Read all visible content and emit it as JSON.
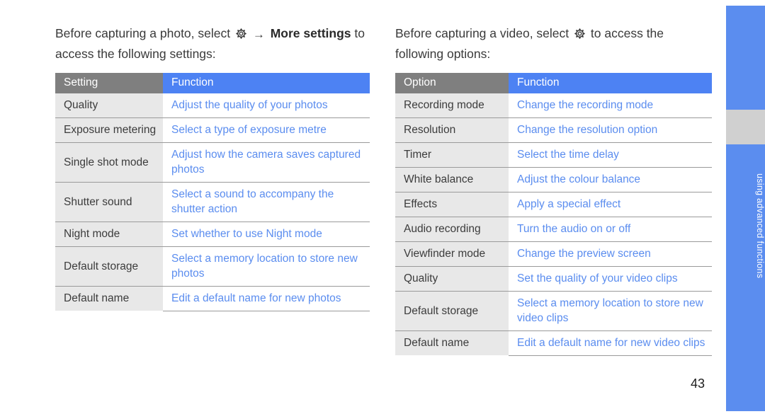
{
  "side_tab": {
    "label": "using advanced functions",
    "color": "#5b8def",
    "gap_color": "#d0d0d0"
  },
  "page_number": "43",
  "colors": {
    "accent_blue": "#5b8def",
    "header_blue": "#4d82f3",
    "header_gray": "#7f7f7f",
    "row_gray": "#e8e8e8"
  },
  "left": {
    "intro_part1": "Before capturing a photo, select",
    "intro_icon": "gear-icon",
    "intro_arrow": "→",
    "intro_bold1": "More settings",
    "intro_part2": "to access the following settings:",
    "headers": [
      "Setting",
      "Function"
    ],
    "rows": [
      {
        "option": "Quality",
        "function": "Adjust the quality of your photos"
      },
      {
        "option": "Exposure metering",
        "function": "Select a type of exposure metre"
      },
      {
        "option": "Single shot mode",
        "function": "Adjust how the camera saves captured photos"
      },
      {
        "option": "Shutter sound",
        "function": "Select a sound to accompany the shutter action"
      },
      {
        "option": "Night mode",
        "function": "Set whether to use Night mode"
      },
      {
        "option": "Default storage",
        "function": "Select a memory location to store new photos"
      },
      {
        "option": "Default name",
        "function": "Edit a default name for new photos"
      }
    ]
  },
  "right": {
    "intro_part1": "Before capturing a video, select",
    "intro_icon": "gear-icon",
    "intro_part2": "to access the following options:",
    "headers": [
      "Option",
      "Function"
    ],
    "rows": [
      {
        "option": "Recording mode",
        "function": "Change the recording mode"
      },
      {
        "option": "Resolution",
        "function": "Change the resolution option"
      },
      {
        "option": "Timer",
        "function": "Select the time delay"
      },
      {
        "option": "White balance",
        "function": "Adjust the colour balance"
      },
      {
        "option": "Effects",
        "function": "Apply a special effect"
      },
      {
        "option": "Audio recording",
        "function": "Turn the audio on or off"
      },
      {
        "option": "Viewfinder mode",
        "function": "Change the preview screen"
      },
      {
        "option": "Quality",
        "function": "Set the quality of your video clips"
      },
      {
        "option": "Default storage",
        "function": "Select a memory location to store new video clips"
      },
      {
        "option": "Default name",
        "function": "Edit a default name for new video clips"
      }
    ]
  }
}
